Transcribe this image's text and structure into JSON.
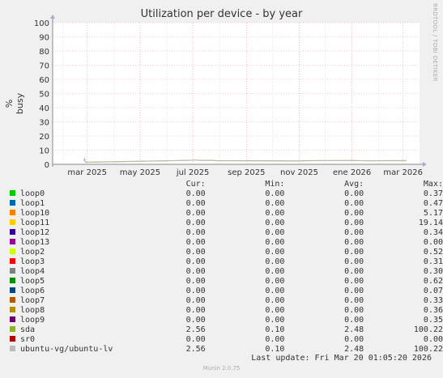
{
  "chart_data": {
    "type": "line",
    "title": "Utilization per device - by year",
    "ylabel": "% busy",
    "ylim": [
      0,
      100
    ],
    "yticks": [
      0,
      10,
      20,
      30,
      40,
      50,
      60,
      70,
      80,
      90,
      100
    ],
    "x_range": [
      "2025-01-20",
      "2026-03-20"
    ],
    "xticks": [
      {
        "date": "2025-03-01",
        "label": "mar 2025"
      },
      {
        "date": "2025-05-01",
        "label": "may 2025"
      },
      {
        "date": "2025-07-01",
        "label": "jul 2025"
      },
      {
        "date": "2025-09-01",
        "label": "sep 2025"
      },
      {
        "date": "2025-11-01",
        "label": "nov 2025"
      },
      {
        "date": "2026-01-01",
        "label": "ene 2026"
      },
      {
        "date": "2026-03-01",
        "label": "mar 2026"
      }
    ],
    "grid": true,
    "series": [
      {
        "name": "sda",
        "color": "#8ab425",
        "points": [
          {
            "x": "2025-02-25",
            "y": 2.5
          },
          {
            "x": "2025-02-26",
            "y": 4.0
          },
          {
            "x": "2025-02-27",
            "y": 1.5
          },
          {
            "x": "2025-06-24",
            "y": 2.8
          },
          {
            "x": "2025-07-05",
            "y": 3.0
          },
          {
            "x": "2025-07-12",
            "y": 2.7
          },
          {
            "x": "2025-07-20",
            "y": 2.9
          },
          {
            "x": "2025-07-28",
            "y": 2.6
          },
          {
            "x": "2025-11-01",
            "y": 2.4
          },
          {
            "x": "2025-11-12",
            "y": 2.6
          },
          {
            "x": "2026-01-03",
            "y": 2.7
          },
          {
            "x": "2026-01-20",
            "y": 2.5
          },
          {
            "x": "2026-02-10",
            "y": 2.6
          },
          {
            "x": "2026-03-05",
            "y": 2.6
          }
        ]
      },
      {
        "name": "ubuntu-vg/ubuntu-lv",
        "color": "#bbbbbb",
        "points": [
          {
            "x": "2025-02-25",
            "y": 2.4
          },
          {
            "x": "2025-02-26",
            "y": 3.8
          },
          {
            "x": "2025-02-27",
            "y": 1.4
          },
          {
            "x": "2025-06-24",
            "y": 2.7
          },
          {
            "x": "2025-07-05",
            "y": 2.9
          },
          {
            "x": "2025-07-12",
            "y": 2.6
          },
          {
            "x": "2025-07-20",
            "y": 2.8
          },
          {
            "x": "2025-07-28",
            "y": 2.5
          },
          {
            "x": "2025-11-01",
            "y": 2.3
          },
          {
            "x": "2025-11-12",
            "y": 2.5
          },
          {
            "x": "2026-01-03",
            "y": 2.6
          },
          {
            "x": "2026-01-20",
            "y": 2.4
          },
          {
            "x": "2026-02-10",
            "y": 2.5
          },
          {
            "x": "2026-03-05",
            "y": 2.5
          }
        ]
      }
    ]
  },
  "legend": {
    "headers": {
      "cur": "Cur:",
      "min": "Min:",
      "avg": "Avg:",
      "max": "Max:"
    },
    "rows": [
      {
        "name": "loop0",
        "color": "#00cc00",
        "cur": "0.00",
        "min": "0.00",
        "avg": "0.00",
        "max": "0.37"
      },
      {
        "name": "loop1",
        "color": "#0066b3",
        "cur": "0.00",
        "min": "0.00",
        "avg": "0.00",
        "max": "0.47"
      },
      {
        "name": "loop10",
        "color": "#ff8000",
        "cur": "0.00",
        "min": "0.00",
        "avg": "0.00",
        "max": "5.17"
      },
      {
        "name": "loop11",
        "color": "#ffcc00",
        "cur": "0.00",
        "min": "0.00",
        "avg": "0.00",
        "max": "19.14"
      },
      {
        "name": "loop12",
        "color": "#330099",
        "cur": "0.00",
        "min": "0.00",
        "avg": "0.00",
        "max": "0.34"
      },
      {
        "name": "loop13",
        "color": "#990099",
        "cur": "0.00",
        "min": "0.00",
        "avg": "0.00",
        "max": "0.00"
      },
      {
        "name": "loop2",
        "color": "#ccff00",
        "cur": "0.00",
        "min": "0.00",
        "avg": "0.00",
        "max": "0.52"
      },
      {
        "name": "loop3",
        "color": "#ff0000",
        "cur": "0.00",
        "min": "0.00",
        "avg": "0.00",
        "max": "0.31"
      },
      {
        "name": "loop4",
        "color": "#808080",
        "cur": "0.00",
        "min": "0.00",
        "avg": "0.00",
        "max": "0.30"
      },
      {
        "name": "loop5",
        "color": "#008f00",
        "cur": "0.00",
        "min": "0.00",
        "avg": "0.00",
        "max": "0.62"
      },
      {
        "name": "loop6",
        "color": "#00487d",
        "cur": "0.00",
        "min": "0.00",
        "avg": "0.00",
        "max": "0.07"
      },
      {
        "name": "loop7",
        "color": "#b35a00",
        "cur": "0.00",
        "min": "0.00",
        "avg": "0.00",
        "max": "0.33"
      },
      {
        "name": "loop8",
        "color": "#b38f00",
        "cur": "0.00",
        "min": "0.00",
        "avg": "0.00",
        "max": "0.36"
      },
      {
        "name": "loop9",
        "color": "#6b006b",
        "cur": "0.00",
        "min": "0.00",
        "avg": "0.00",
        "max": "0.35"
      },
      {
        "name": "sda",
        "color": "#8ab425",
        "cur": "2.56",
        "min": "0.10",
        "avg": "2.48",
        "max": "100.22"
      },
      {
        "name": "sr0",
        "color": "#b30000",
        "cur": "0.00",
        "min": "0.00",
        "avg": "0.00",
        "max": "0.00"
      },
      {
        "name": "ubuntu-vg/ubuntu-lv",
        "color": "#bbbbbb",
        "cur": "2.56",
        "min": "0.10",
        "avg": "2.48",
        "max": "100.22"
      }
    ]
  },
  "last_update": "Last update: Fri Mar 20 01:05:20 2026",
  "watermark": "RRDTOOL / TOBI OETIKER",
  "footer": "Munin 2.0.75"
}
